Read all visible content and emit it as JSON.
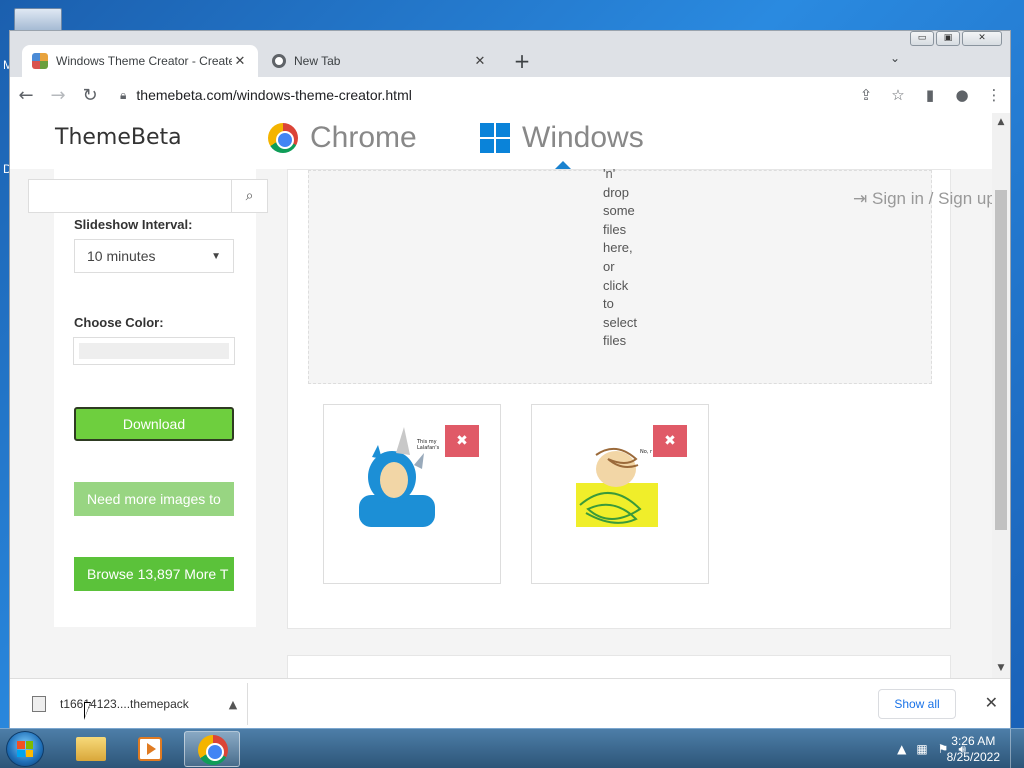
{
  "browser": {
    "tabs": [
      {
        "title": "Windows Theme Creator - Create",
        "close": "✕"
      },
      {
        "title": "New Tab",
        "close": "✕"
      }
    ],
    "new_tab": "+",
    "tab_menu": "⌄",
    "url": "themebeta.com/windows-theme-creator.html",
    "window_controls": {
      "minimize": "▭",
      "maximize": "▣",
      "close": "✕"
    }
  },
  "site": {
    "brand": "ThemeBeta",
    "nav": {
      "chrome": "Chrome",
      "windows": "Windows"
    },
    "signin": "Sign in / Sign up"
  },
  "sidebar": {
    "slideshow_label": "Slideshow Interval:",
    "slideshow_value": "10 minutes",
    "color_label": "Choose Color:",
    "download_label": "Download",
    "more_images_label": "Need more images to",
    "browse_label": "Browse 13,897 More T"
  },
  "dropzone": {
    "text_lines": [
      "'n'",
      "drop",
      "some",
      "files",
      "here,",
      "or",
      "click",
      "to",
      "select",
      "files"
    ]
  },
  "thumbnails": [
    {
      "caption": "This my Lalafan's",
      "remove": "✖"
    },
    {
      "caption": "No, r",
      "remove": "✖"
    }
  ],
  "download_bar": {
    "filename": "t16614123....themepack",
    "show_all": "Show all",
    "close": "✕"
  },
  "taskbar": {
    "time": "3:26 AM",
    "date": "8/25/2022"
  },
  "desktop": {
    "left_letters": [
      "M",
      "D"
    ]
  },
  "colors": {
    "download_green": "#6ecf3e",
    "more_green": "#98d582",
    "browse_green": "#5bc23a",
    "remove_red": "#e05a67",
    "link_blue": "#1a73e8"
  }
}
